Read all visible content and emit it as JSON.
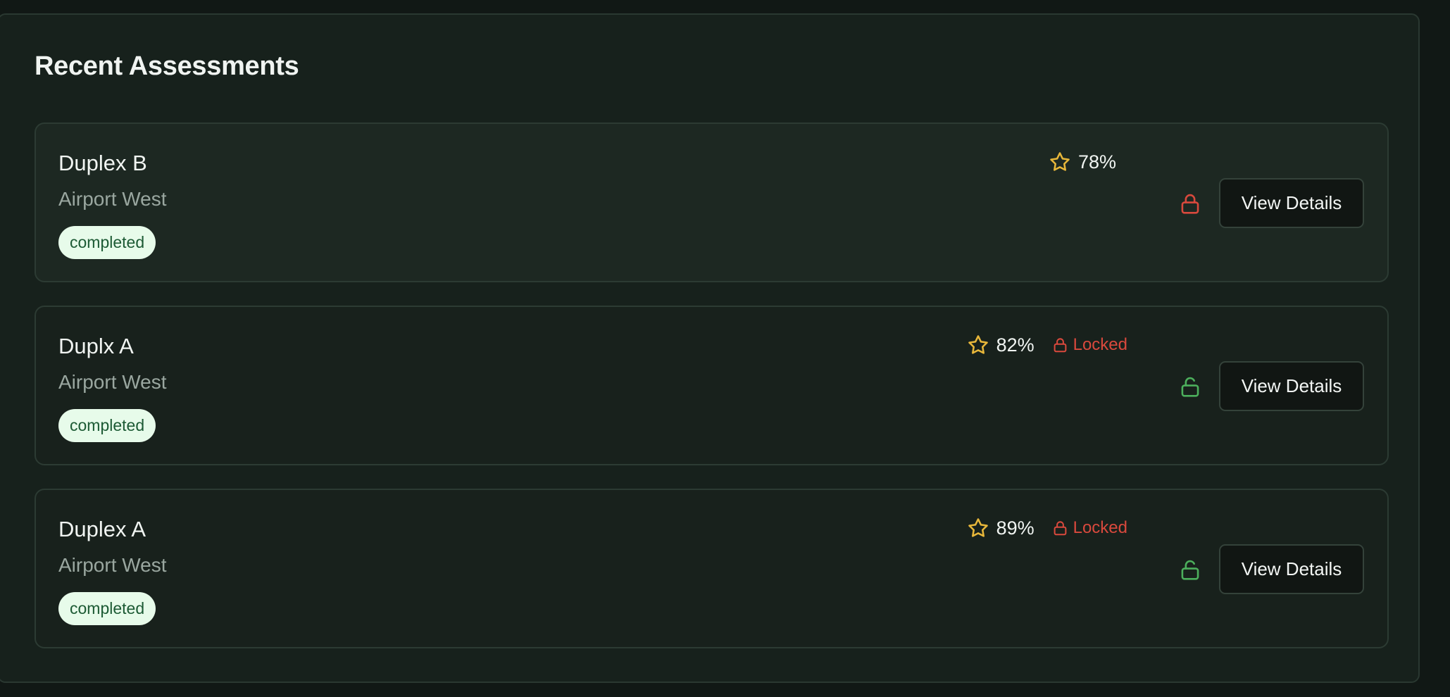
{
  "panel": {
    "title": "Recent Assessments"
  },
  "colors": {
    "star": "#e8b73a",
    "locked": "#d9493d",
    "unlocked": "#4caf5c",
    "badge_bg": "#e7fbea",
    "badge_text": "#1c5a34"
  },
  "assessments": [
    {
      "name": "Duplex B",
      "location": "Airport West",
      "status": "completed",
      "score": "78%",
      "locked_label": "",
      "lock_icon": "lock-closed-icon",
      "action_label": "View Details"
    },
    {
      "name": "Duplx A",
      "location": "Airport West",
      "status": "completed",
      "score": "82%",
      "locked_label": "Locked",
      "lock_icon": "lock-open-icon",
      "action_label": "View Details"
    },
    {
      "name": "Duplex A",
      "location": "Airport West",
      "status": "completed",
      "score": "89%",
      "locked_label": "Locked",
      "lock_icon": "lock-open-icon",
      "action_label": "View Details"
    }
  ]
}
